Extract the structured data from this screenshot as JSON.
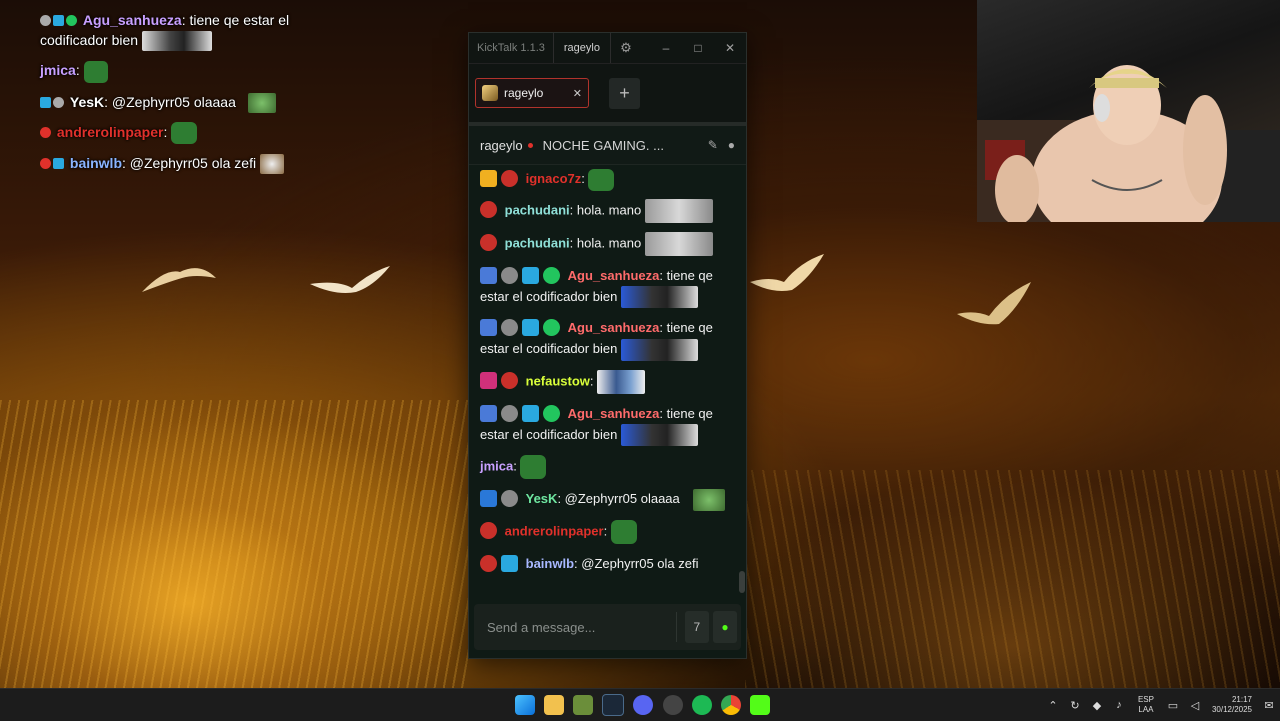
{
  "overlay_chat": [
    {
      "user": "Agu_sanhueza",
      "user_color": "#c9a0ff",
      "text": "tiene qe estar el codificador bien",
      "badges": [
        "#aaaaaa",
        "#2aa9e0",
        "#22c55e"
      ],
      "emote": "thumb"
    },
    {
      "user": "jmica",
      "user_color": "#c9a0ff",
      "text": "",
      "badges": [],
      "emote": "pepe"
    },
    {
      "user": "YesK",
      "user_color": "#ffffff",
      "text": "@Zephyrr05 olaaaa",
      "badges": [
        "#2aa9e0",
        "#aaaaaa"
      ],
      "emote": "goblin"
    },
    {
      "user": "andrerolinpaper",
      "user_color": "#e0312b",
      "text": "",
      "badges": [
        "#e0312b"
      ],
      "emote": "pepe"
    },
    {
      "user": "bainwlb",
      "user_color": "#8ab4ff",
      "text": "@Zephyrr05 ola zefi",
      "badges": [
        "#e0312b",
        "#2aa9e0"
      ],
      "emote": "cow"
    }
  ],
  "window": {
    "app_title": "KickTalk 1.1.3",
    "channel": "rageylo",
    "settings_icon": "gear-icon",
    "minimize": "–",
    "maximize": "□",
    "close": "✕"
  },
  "tabs": [
    {
      "label": "rageylo",
      "close": "✕"
    }
  ],
  "add_tab_label": "+",
  "channel_header": {
    "name": "rageylo",
    "title": "NOCHE GAMING. ...",
    "pin_icon": "pin-icon",
    "user_icon": "user-icon"
  },
  "messages": [
    {
      "user": "ignaco7z",
      "color": "#e0312b",
      "text": "",
      "badges": [
        "7tv",
        "sub"
      ],
      "emote": "pepe"
    },
    {
      "user": "pachudani",
      "color": "#8fe0d8",
      "text": "hola. mano",
      "badges": [
        "sub"
      ],
      "emote": "cat"
    },
    {
      "user": "pachudani",
      "color": "#8fe0d8",
      "text": "hola. mano",
      "badges": [
        "sub"
      ],
      "emote": "cat"
    },
    {
      "user": "Agu_sanhueza",
      "color": "#ff6b6b",
      "text": "tiene qe estar el codificador bien",
      "badges": [
        "mod",
        "gift",
        "cube",
        "verified"
      ],
      "emote": "face"
    },
    {
      "user": "Agu_sanhueza",
      "color": "#ff6b6b",
      "text": "tiene qe estar el codificador bien",
      "badges": [
        "mod",
        "gift",
        "cube",
        "verified"
      ],
      "emote": "face"
    },
    {
      "user": "nefaustow",
      "color": "#d9ff3a",
      "text": "",
      "badges": [
        "7tvpink",
        "sub"
      ],
      "emote": "people"
    },
    {
      "user": "Agu_sanhueza",
      "color": "#ff6b6b",
      "text": "tiene qe estar el codificador bien",
      "badges": [
        "mod",
        "gift",
        "cube",
        "verified"
      ],
      "emote": "face"
    },
    {
      "user": "jmica",
      "color": "#c9a0ff",
      "text": "",
      "badges": [],
      "emote": "pepe"
    },
    {
      "user": "YesK",
      "color": "#6ee6a0",
      "text": "@Zephyrr05 olaaaa",
      "badges": [
        "mod2",
        "gift"
      ],
      "emote": "goblin"
    },
    {
      "user": "andrerolinpaper",
      "color": "#e0312b",
      "text": "",
      "badges": [
        "sub"
      ],
      "emote": "pepe2"
    },
    {
      "user": "bainwlb",
      "color": "#a8b8ff",
      "text": "@Zephyrr05 ola zefi",
      "badges": [
        "sub",
        "cube"
      ],
      "emote": "none"
    }
  ],
  "input": {
    "placeholder": "Send a message...",
    "emote_7tv_icon": "7tv-icon",
    "emote_kick_icon": "kick-emote-icon"
  },
  "taskbar": {
    "apps": [
      "windows-start",
      "file-explorer",
      "minecraft",
      "steam",
      "discord",
      "obs",
      "spotify",
      "chrome",
      "kick"
    ],
    "lang_top": "ESP",
    "lang_bottom": "LAA",
    "time": "21:17",
    "date": "30/12/2025"
  },
  "colors": {
    "kick_green": "#53fc18",
    "accent_red": "#e0312b"
  }
}
